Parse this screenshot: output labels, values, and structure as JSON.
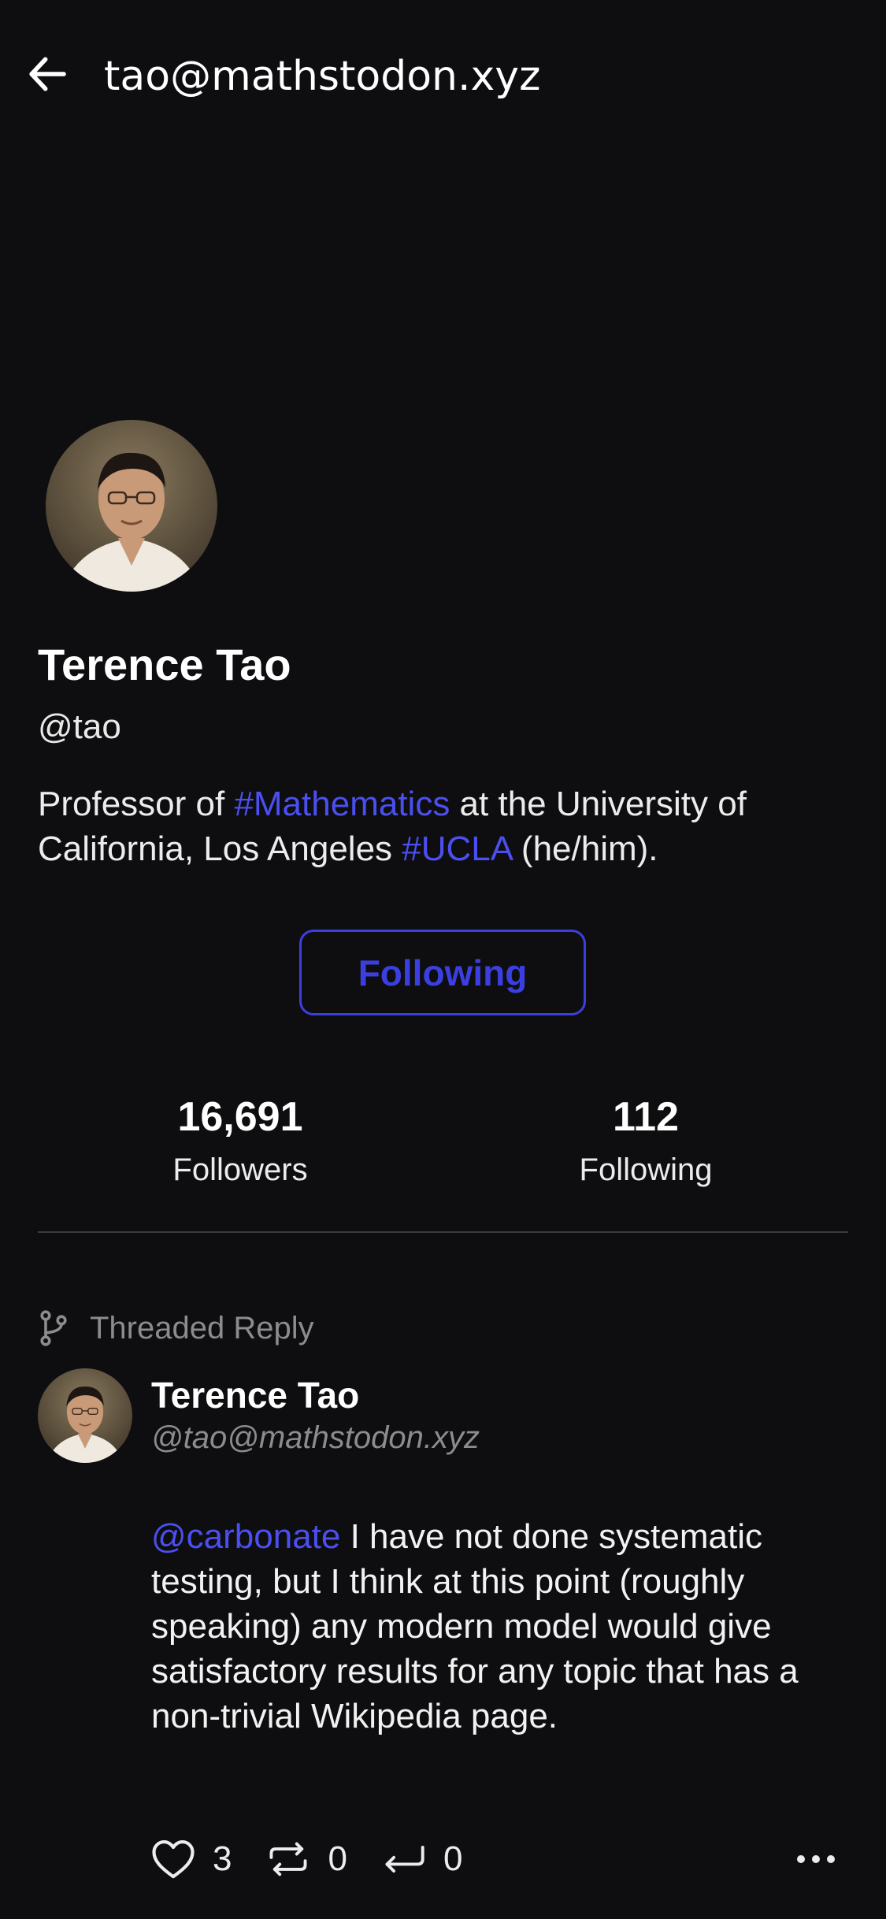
{
  "topbar": {
    "back_icon": "arrow-left-icon",
    "title": "tao@mathstodon.xyz"
  },
  "profile": {
    "display_name": "Terence Tao",
    "handle": "@tao",
    "bio": {
      "part1": "Professor of ",
      "tag1": "#Mathematics",
      "part2": " at the University of California, Los Angeles ",
      "tag2": "#UCLA",
      "part3": " (he/him)."
    },
    "follow_button_label": "Following",
    "stats": {
      "followers_count": "16,691",
      "followers_label": "Followers",
      "following_count": "112",
      "following_label": "Following"
    }
  },
  "post": {
    "context_label": "Threaded Reply",
    "context_icon": "git-branch-icon",
    "author_name": "Terence Tao",
    "author_handle": "@tao@mathstodon.xyz",
    "mention": "@carbonate",
    "body": " I have not done systematic testing, but I think at this point (roughly speaking) any modern model would give satisfactory results for any topic that has a non-trivial Wikipedia page.",
    "actions": {
      "likes": "3",
      "boosts": "0",
      "replies": "0"
    }
  },
  "colors": {
    "background": "#0e0e10",
    "accent": "#3b3fe0",
    "link": "#4b4ff0",
    "muted": "#8b8b90"
  }
}
